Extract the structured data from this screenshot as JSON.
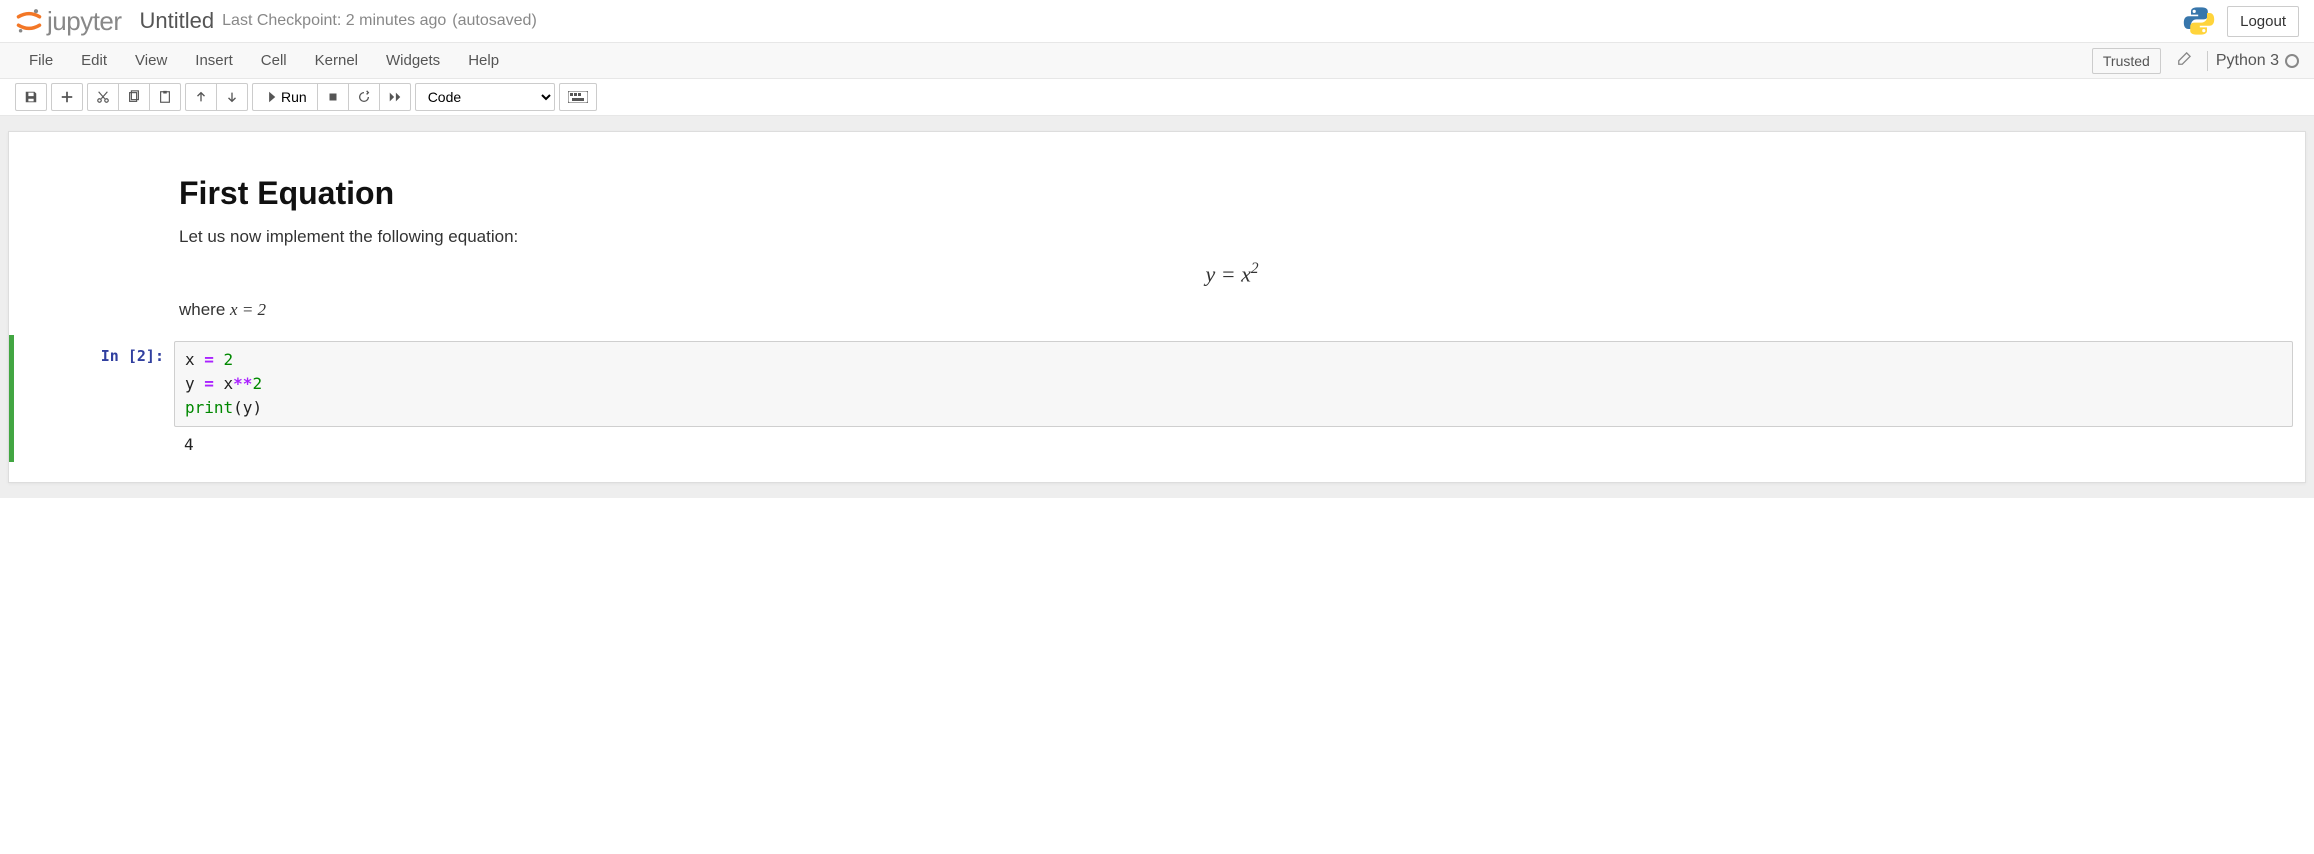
{
  "header": {
    "logo_text": "jupyter",
    "notebook_name": "Untitled",
    "checkpoint": "Last Checkpoint: 2 minutes ago",
    "autosaved": "(autosaved)",
    "logout": "Logout"
  },
  "menubar": {
    "items": [
      "File",
      "Edit",
      "View",
      "Insert",
      "Cell",
      "Kernel",
      "Widgets",
      "Help"
    ],
    "trusted": "Trusted",
    "kernel": "Python 3"
  },
  "toolbar": {
    "run_label": "Run",
    "celltype_value": "Code"
  },
  "cells": {
    "markdown": {
      "heading": "First Equation",
      "intro": "Let us now implement the following equation:",
      "equation": "y = x",
      "equation_sup": "2",
      "where": "where ",
      "where_math": "x = 2"
    },
    "code": {
      "prompt": "In [2]:",
      "line1_lhs": "x ",
      "line1_op": "=",
      "line1_rhs": " 2",
      "line2_lhs": "y ",
      "line2_op1": "=",
      "line2_mid": " x",
      "line2_op2": "**",
      "line2_rhs": "2",
      "line3_func": "print",
      "line3_rest": "(y)",
      "output": "4"
    }
  }
}
